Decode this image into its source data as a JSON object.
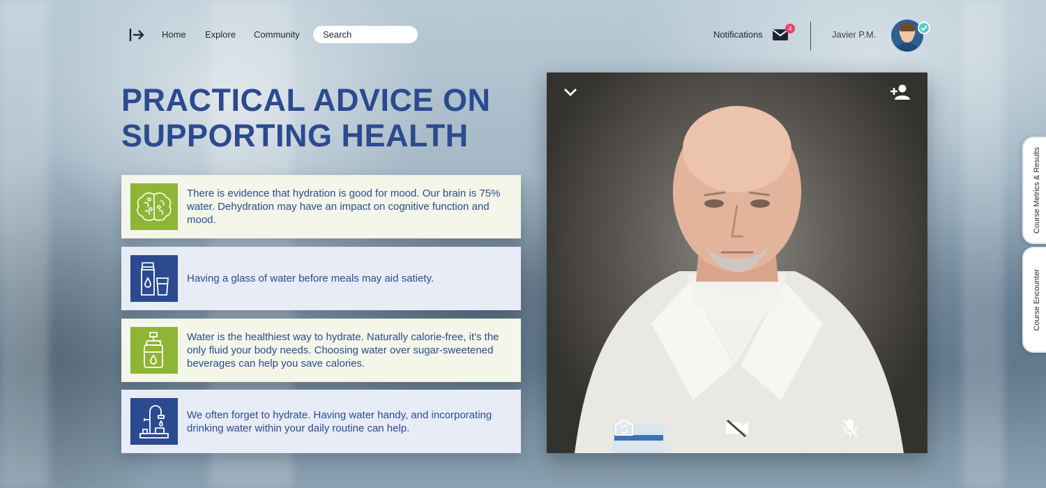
{
  "nav": {
    "links": [
      "Home",
      "Explore",
      "Community"
    ],
    "search_placeholder": "Search",
    "notifications_label": "Notifications",
    "notification_count": "4",
    "user_name": "Javier P.M."
  },
  "headline": {
    "line1": "PRACTICAL ADVICE ON",
    "line2": "SUPPORTING HEALTH"
  },
  "tips": [
    {
      "icon": "brain-icon",
      "text": "There is evidence that hydration is good for mood. Our brain is 75% water. Dehydration may have an impact on cognitive function and mood."
    },
    {
      "icon": "water-bottle-glass-icon",
      "text": "Having a glass of water before meals may aid satiety."
    },
    {
      "icon": "water-dispenser-icon",
      "text": "Water is the healthiest way to hydrate. Naturally calorie-free, it's the only fluid your body needs. Choosing water over sugar-sweetened beverages can help you save calories."
    },
    {
      "icon": "faucet-icon",
      "text": "We often forget to hydrate. Having water handy, and incorporating drinking water within your daily routine can help."
    }
  ],
  "side_tabs": [
    "Course Metrics & Results",
    "Course Encounter"
  ],
  "colors": {
    "headline": "#2b4a8f",
    "accent_green": "#8eb536",
    "accent_blue": "#2b4a8f",
    "badge": "#e8426b",
    "verified": "#4fd1c5"
  }
}
